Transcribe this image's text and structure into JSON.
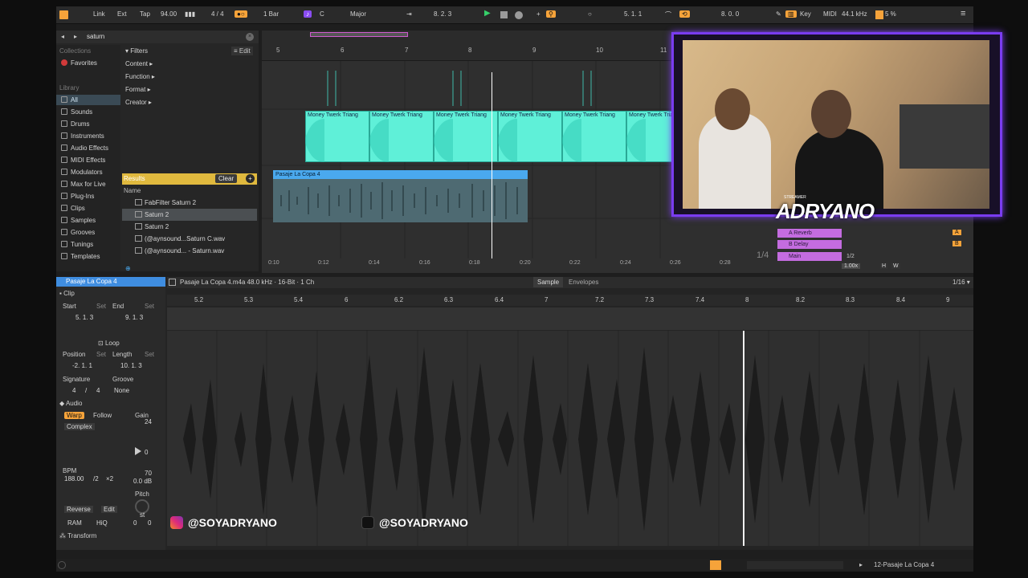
{
  "transport": {
    "link": "Link",
    "ext": "Ext",
    "tap": "Tap",
    "tempo": "94.00",
    "time_sig": "4 / 4",
    "quantize": "1 Bar",
    "key_root": "C",
    "scale": "Major",
    "position": "8.  2.  3",
    "loop_start": "5.  1.  1",
    "loop_length": "8.  0.  0",
    "key_label": "Key",
    "midi_label": "MIDI",
    "sample_rate": "44.1 kHz",
    "cpu": "5 %"
  },
  "browser": {
    "search_value": "saturn",
    "collections_head": "Collections",
    "favorites": "Favorites",
    "library_head": "Library",
    "library_items": [
      "All",
      "Sounds",
      "Drums",
      "Instruments",
      "Audio Effects",
      "MIDI Effects",
      "Modulators",
      "Max for Live",
      "Plug-Ins",
      "Clips",
      "Samples",
      "Grooves",
      "Tunings",
      "Templates"
    ],
    "filters_label": "Filters",
    "edit_label": "Edit",
    "filter_items": [
      "Content",
      "Function",
      "Format",
      "Creator"
    ],
    "results_label": "Results",
    "clear_label": "Clear",
    "name_col": "Name",
    "results": [
      "FabFilter Saturn 2",
      "Saturn 2",
      "Saturn 2",
      "(@aynsound...Saturn C.wav",
      "(@aynsound... - Saturn.wav"
    ]
  },
  "arrangement": {
    "bar_numbers": [
      "5",
      "6",
      "7",
      "8",
      "9",
      "10",
      "11"
    ],
    "time_labels": [
      "0:10",
      "0:12",
      "0:14",
      "0:16",
      "0:18",
      "0:20",
      "0:22",
      "0:24",
      "0:26",
      "0:28"
    ],
    "midi_clip_label": "Money Twerk Triang",
    "audio_clip_label": "Pasaje La Copa 4",
    "quant_display": "1/4",
    "returns": [
      "A Reverb",
      "B Delay",
      "Main"
    ],
    "return_letters": [
      "A",
      "B"
    ],
    "solo": "S",
    "post": "Post",
    "zoom": "1.00x",
    "hw": [
      "H",
      "W"
    ],
    "half": "1/2",
    "vol_a": "0",
    "vol_main": "-0.1"
  },
  "overlay": {
    "streamer_tag": "STREAMER",
    "name": "ADRYANO"
  },
  "clip": {
    "title": "Pasaje La Copa 4",
    "section_clip": "Clip",
    "start_label": "Start",
    "end_label": "End",
    "set_label": "Set",
    "start_val": "5.  1.  3",
    "end_val": "9.  1.  3",
    "loop_label": "Loop",
    "position_label": "Position",
    "length_label": "Length",
    "position_val": "-2.  1.  1",
    "length_val": "10.  1.  3",
    "signature_label": "Signature",
    "groove_label": "Groove",
    "sig_num": "4",
    "sig_den": "4",
    "groove_val": "None",
    "audio_label": "Audio",
    "warp": "Warp",
    "follow": "Follow",
    "gain_label": "Gain",
    "warp_mode": "Complex",
    "gain_24": "24",
    "gain_0": "0",
    "gain_70": "70",
    "gain_db": "0.0 dB",
    "bpm_label": "BPM",
    "bpm_val": "188.00",
    "half": "/2",
    "double": "×2",
    "pitch_label": "Pitch",
    "pitch_st": "st",
    "reverse": "Reverse",
    "edit": "Edit",
    "ram": "RAM",
    "hiq": "HiQ",
    "pitch_vals": [
      "0",
      "0"
    ],
    "transform": "Transform"
  },
  "sample": {
    "file_info": "Pasaje La Copa 4.m4a  48.0 kHz · 16-Bit · 1 Ch",
    "tab_sample": "Sample",
    "tab_envelopes": "Envelopes",
    "grid": "1/16",
    "ruler": [
      "5.2",
      "5.3",
      "5.4",
      "6",
      "6.2",
      "6.3",
      "6.4",
      "7",
      "7.2",
      "7.3",
      "7.4",
      "8",
      "8.2",
      "8.3",
      "8.4",
      "9"
    ]
  },
  "socials": {
    "instagram": "@SOYADRYANO",
    "tiktok": "@SOYADRYANO"
  },
  "status": {
    "track": "12-Pasaje La Copa 4"
  },
  "colors": {
    "accent_orange": "#f6a33a",
    "purple": "#8a4df1",
    "midi_clip": "#5ff0d8",
    "audio_clip": "#4aa9ee",
    "results_bar": "#e0b93e"
  }
}
